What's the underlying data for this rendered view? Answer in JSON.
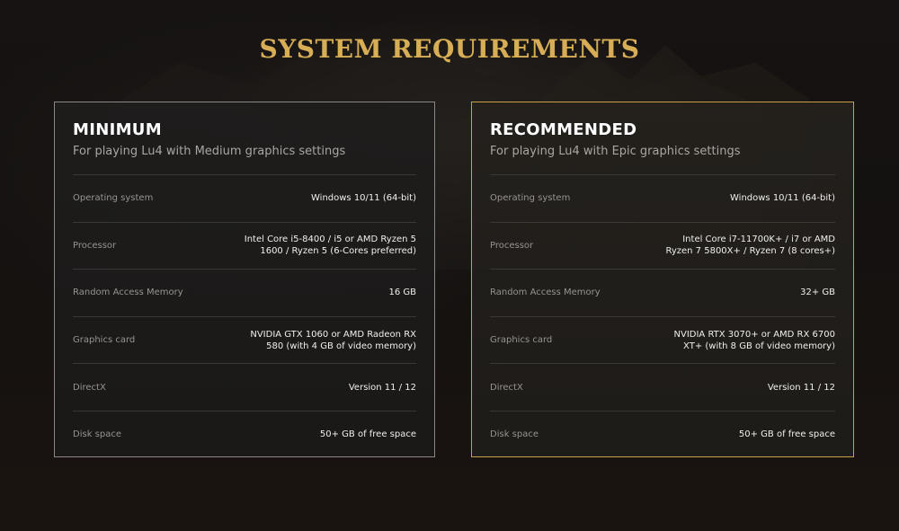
{
  "page": {
    "title": "SYSTEM REQUIREMENTS"
  },
  "colors": {
    "accent_gold": "#d7ae55",
    "recommended_border": "#c7a047",
    "minimum_border": "#8a8785",
    "background": "#121010"
  },
  "minimum": {
    "title": "MINIMUM",
    "subtitle": "For playing Lu4 with Medium graphics settings",
    "rows": [
      {
        "label": "Operating system",
        "value": "Windows 10/11 (64-bit)"
      },
      {
        "label": "Processor",
        "value": "Intel Core i5-8400 / i5 or AMD Ryzen 5 1600 / Ryzen 5 (6-Cores preferred)"
      },
      {
        "label": "Random Access Memory",
        "value": "16 GB"
      },
      {
        "label": "Graphics card",
        "value": "NVIDIA GTX 1060 or AMD Radeon RX 580 (with 4 GB of video memory)"
      },
      {
        "label": "DirectX",
        "value": "Version 11 / 12"
      },
      {
        "label": "Disk space",
        "value": "50+ GB of free space"
      }
    ]
  },
  "recommended": {
    "title": "RECOMMENDED",
    "subtitle": "For playing Lu4 with Epic graphics settings",
    "rows": [
      {
        "label": "Operating system",
        "value": "Windows 10/11 (64-bit)"
      },
      {
        "label": "Processor",
        "value": "Intel Core i7-11700K+ / i7 or AMD Ryzen 7 5800X+ / Ryzen 7 (8 cores+)"
      },
      {
        "label": "Random Access Memory",
        "value": "32+ GB"
      },
      {
        "label": "Graphics card",
        "value": "NVIDIA RTX 3070+ or AMD RX 6700 XT+ (with 8 GB of video memory)"
      },
      {
        "label": "DirectX",
        "value": "Version 11 / 12"
      },
      {
        "label": "Disk space",
        "value": "50+ GB of free space"
      }
    ]
  }
}
